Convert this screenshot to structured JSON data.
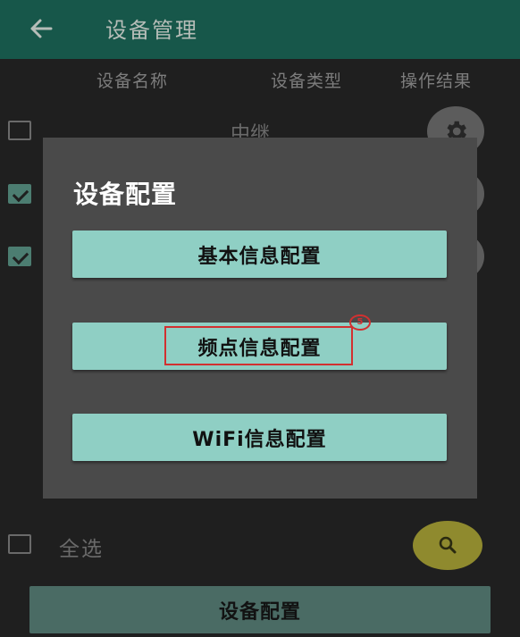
{
  "appbar": {
    "title": "设备管理",
    "back_icon": "arrow-left-icon"
  },
  "table": {
    "headers": [
      "设备名称",
      "设备类型",
      "操作结果"
    ],
    "rows": [
      {
        "name": "中继",
        "checked": false
      },
      {
        "name": "",
        "checked": true
      },
      {
        "name": "",
        "checked": true
      }
    ],
    "row_action_icon": "gear-icon"
  },
  "dialog": {
    "title": "设备配置",
    "buttons": [
      "基本信息配置",
      "频点信息配置",
      "WiFi信息配置"
    ]
  },
  "annotation": {
    "step_number": "5",
    "color": "#d23030"
  },
  "footer": {
    "select_all_label": "全选",
    "select_all_checked": false,
    "search_icon": "search-icon",
    "config_button_label": "设备配置"
  },
  "colors": {
    "appbar": "#17574a",
    "dialog_button": "#8fcfc4",
    "fab": "#8f8a2e"
  }
}
